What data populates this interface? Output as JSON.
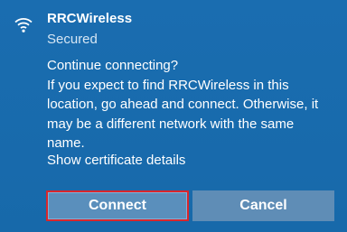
{
  "network": {
    "name": "RRCWireless",
    "status": "Secured",
    "icon": "wifi-icon"
  },
  "prompt": {
    "question": "Continue connecting?",
    "lines": [
      "If you expect to find RRCWireless in this",
      "location, go ahead and connect. Otherwise, it",
      "may be a different network with the same",
      "name."
    ],
    "cert_link": "Show certificate details"
  },
  "buttons": {
    "connect": "Connect",
    "cancel": "Cancel"
  },
  "colors": {
    "background": "#1769aa",
    "button": "#5a8fbc",
    "focus_border": "#d9262c"
  }
}
